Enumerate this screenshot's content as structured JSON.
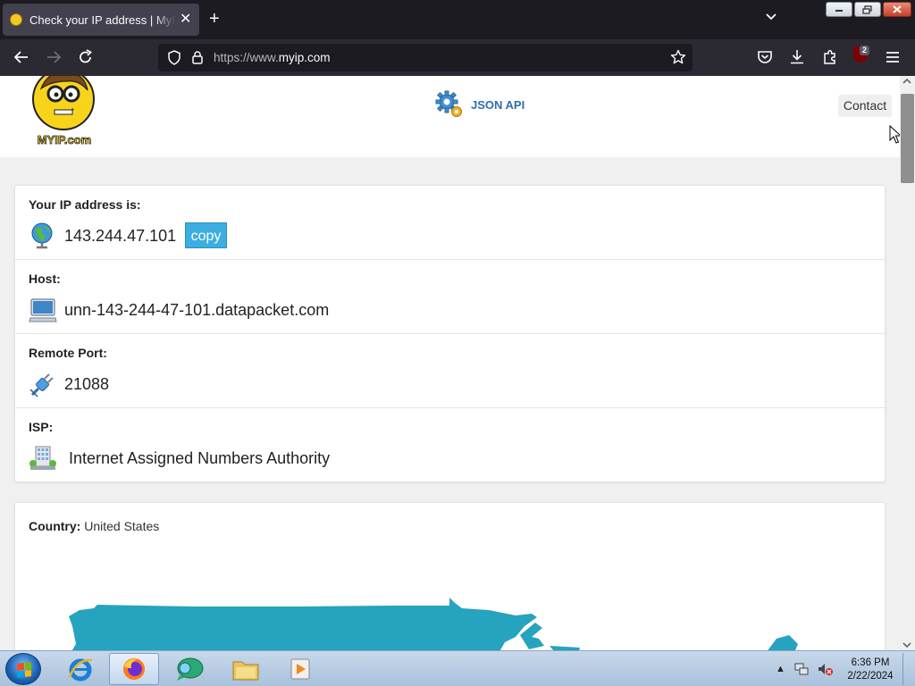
{
  "browser": {
    "tab_title": "Check your IP address | MyIP.com",
    "tab_close": "✕",
    "new_tab": "+",
    "url_prefix": "https://www.",
    "url_domain": "myip.com",
    "extension_badge": "2"
  },
  "site": {
    "logo_text": "MYIP.com",
    "json_api_label": "JSON API",
    "contact_label": "Contact"
  },
  "ip_card": {
    "rows": [
      {
        "label": "Your IP address is:",
        "value": "143.244.47.101",
        "icon": "globe-icon"
      },
      {
        "label": "Host:",
        "value": "unn-143-244-47-101.datapacket.com",
        "icon": "computer-icon"
      },
      {
        "label": "Remote Port:",
        "value": "21088",
        "icon": "plug-icon"
      },
      {
        "label": "ISP:",
        "value": "Internet Assigned Numbers Authority",
        "icon": "building-icon"
      }
    ],
    "copy_label": "copy"
  },
  "country_card": {
    "label": "Country:",
    "value": "United States",
    "map_color": "#26a3be"
  },
  "taskbar": {
    "time": "6:36 PM",
    "date": "2/22/2024"
  }
}
